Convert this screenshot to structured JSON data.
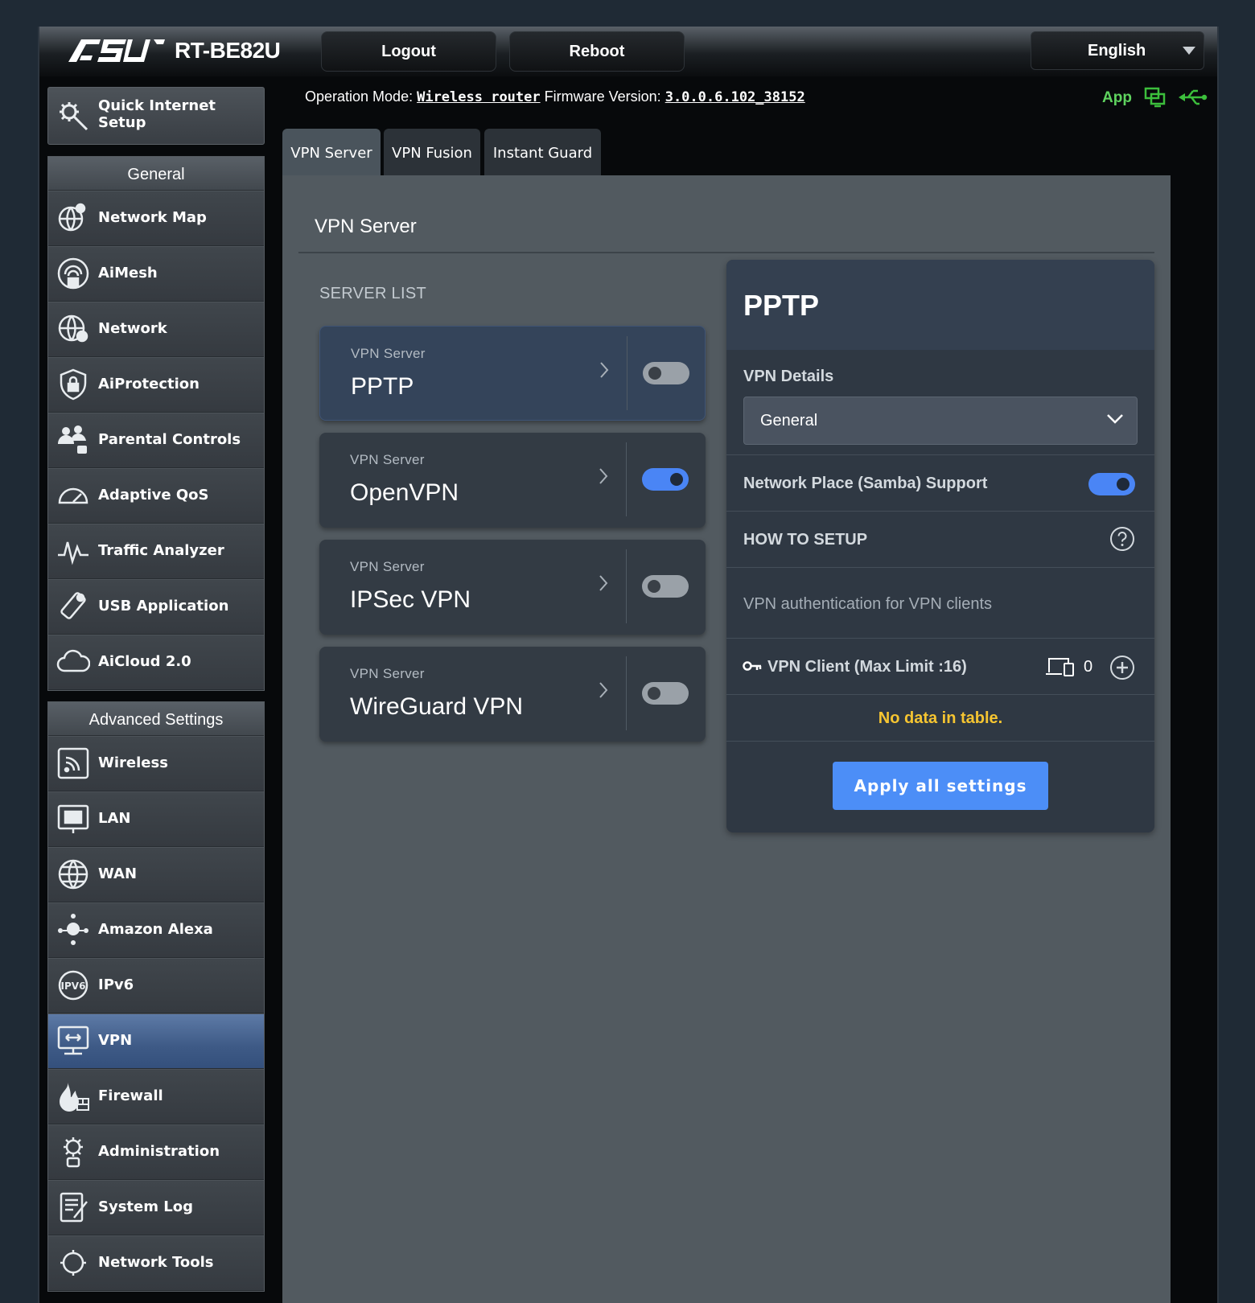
{
  "header": {
    "brand": "ASUS",
    "model": "RT-BE82U",
    "logout_label": "Logout",
    "reboot_label": "Reboot",
    "language": "English"
  },
  "status": {
    "operation_mode_label": "Operation Mode:",
    "operation_mode_value": "Wireless router",
    "firmware_label": "Firmware Version:",
    "firmware_value": "3.0.0.6.102_38152",
    "app_label": "App"
  },
  "sidebar": {
    "qis_label": "Quick Internet Setup",
    "general_header": "General",
    "general_items": [
      {
        "label": "Network Map",
        "icon": "network-map-icon"
      },
      {
        "label": "AiMesh",
        "icon": "aimesh-icon"
      },
      {
        "label": "Network",
        "icon": "network-globe-icon"
      },
      {
        "label": "AiProtection",
        "icon": "aiprotection-icon"
      },
      {
        "label": "Parental Controls",
        "icon": "parental-controls-icon"
      },
      {
        "label": "Adaptive QoS",
        "icon": "qos-gauge-icon"
      },
      {
        "label": "Traffic Analyzer",
        "icon": "traffic-analyzer-icon"
      },
      {
        "label": "USB Application",
        "icon": "usb-application-icon"
      },
      {
        "label": "AiCloud 2.0",
        "icon": "aicloud-icon"
      }
    ],
    "advanced_header": "Advanced Settings",
    "advanced_items": [
      {
        "label": "Wireless",
        "icon": "wireless-icon"
      },
      {
        "label": "LAN",
        "icon": "lan-icon"
      },
      {
        "label": "WAN",
        "icon": "wan-globe-icon"
      },
      {
        "label": "Amazon Alexa",
        "icon": "alexa-icon"
      },
      {
        "label": "IPv6",
        "icon": "ipv6-icon"
      },
      {
        "label": "VPN",
        "icon": "vpn-icon",
        "active": true
      },
      {
        "label": "Firewall",
        "icon": "firewall-icon"
      },
      {
        "label": "Administration",
        "icon": "administration-icon"
      },
      {
        "label": "System Log",
        "icon": "system-log-icon"
      },
      {
        "label": "Network Tools",
        "icon": "network-tools-icon"
      }
    ]
  },
  "tabs": [
    {
      "label": "VPN Server",
      "active": true
    },
    {
      "label": "VPN Fusion"
    },
    {
      "label": "Instant Guard"
    }
  ],
  "main": {
    "page_title": "VPN Server",
    "server_list_label": "SERVER LIST",
    "servers": [
      {
        "sub": "VPN Server",
        "name": "PPTP",
        "enabled": false,
        "selected": true
      },
      {
        "sub": "VPN Server",
        "name": "OpenVPN",
        "enabled": true
      },
      {
        "sub": "VPN Server",
        "name": "IPSec VPN",
        "enabled": false
      },
      {
        "sub": "VPN Server",
        "name": "WireGuard VPN",
        "enabled": false
      }
    ]
  },
  "panel": {
    "title": "PPTP",
    "vpn_details_label": "VPN Details",
    "vpn_details_value": "General",
    "samba_label": "Network Place (Samba) Support",
    "samba_enabled": true,
    "how_to_setup_label": "HOW TO SETUP",
    "auth_text": "VPN authentication for VPN clients",
    "client_label": "VPN Client (Max Limit :16)",
    "client_count": "0",
    "no_data": "No data in table.",
    "apply_label": "Apply all settings"
  },
  "colors": {
    "accent_blue": "#4c8ef7",
    "toggle_on": "#4a85f5",
    "app_green": "#5fd35f",
    "no_data_yellow": "#f6c531"
  }
}
